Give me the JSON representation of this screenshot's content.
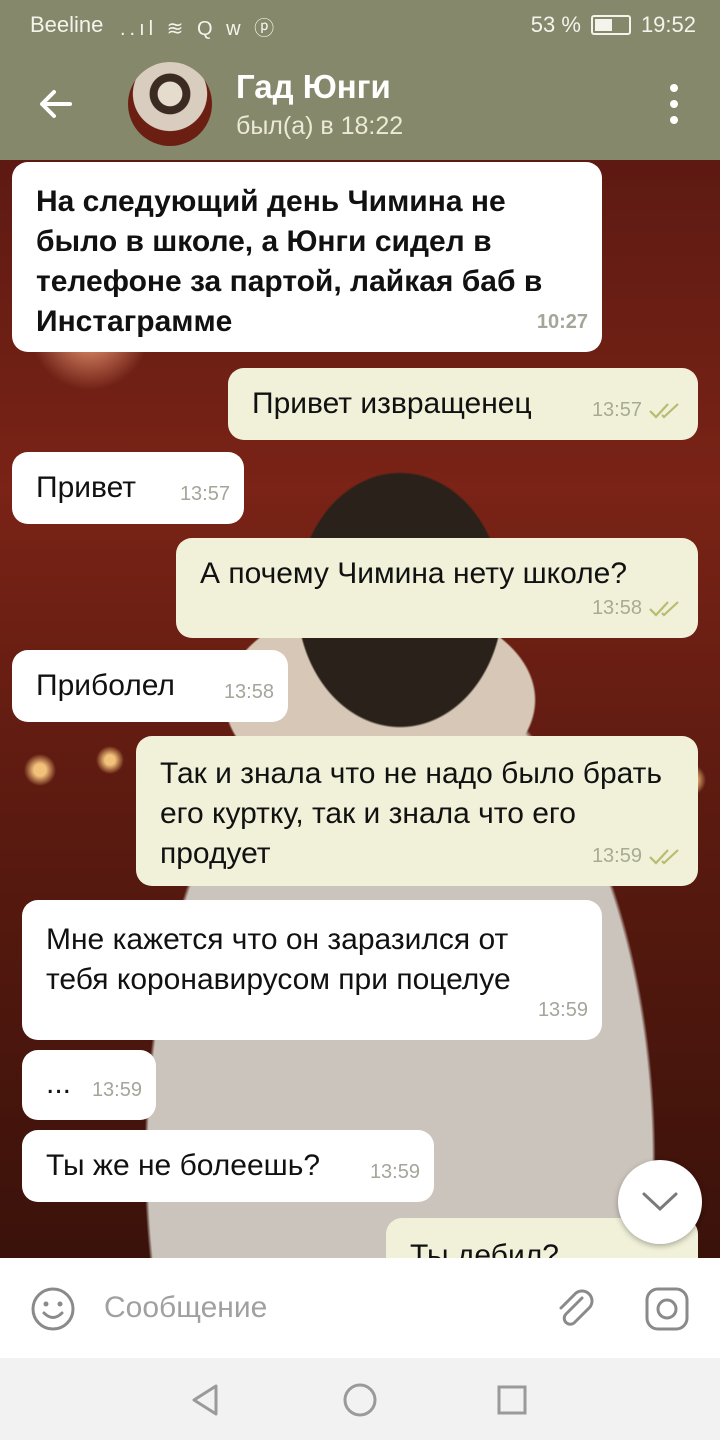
{
  "status_bar": {
    "carrier": "Beeline",
    "signal_icons": "..ıl ≋ Q w ⓟ",
    "battery_percent": "53 %",
    "battery_level": 0.53,
    "time": "19:52"
  },
  "header": {
    "contact_name": "Гад Юнги",
    "last_seen": "был(а) в 18:22"
  },
  "messages": [
    {
      "dir": "in",
      "text": "На следующий день Чимина не было в школе, а Юнги сидел в телефоне за партой, лайкая баб в Инстаграмме",
      "time": "10:27"
    },
    {
      "dir": "out",
      "text": "Привет извращенец",
      "time": "13:57"
    },
    {
      "dir": "in",
      "text": "Привет",
      "time": "13:57"
    },
    {
      "dir": "out",
      "text": "А почему Чимина нету школе?",
      "time": "13:58"
    },
    {
      "dir": "in",
      "text": "Приболел",
      "time": "13:58"
    },
    {
      "dir": "out",
      "text": "Так и знала что не надо было брать его куртку, так и знала что его продует",
      "time": "13:59"
    },
    {
      "dir": "in",
      "text": "Мне кажется что он заразился от тебя коронавирусом при поцелуе",
      "time": "13:59"
    },
    {
      "dir": "in",
      "text": "...",
      "time": "13:59"
    },
    {
      "dir": "in",
      "text": "Ты же не болеешь?",
      "time": "13:59"
    },
    {
      "dir": "out",
      "text": "Ты дебил?",
      "time": ""
    }
  ],
  "input": {
    "placeholder": "Сообщение"
  },
  "icons": {
    "back": "arrow-left-icon",
    "menu": "more-vert-icon",
    "scroll": "chevron-down-icon",
    "emoji": "smile-icon",
    "attach": "paperclip-icon",
    "camera": "instagram-camera-icon",
    "nav_back": "triangle-back-icon",
    "nav_home": "circle-home-icon",
    "nav_recent": "square-recent-icon"
  },
  "colors": {
    "header_bg": "#85886a",
    "bubble_in": "#ffffff",
    "bubble_out": "#f1f0d9",
    "read_check": "#b9bc70"
  }
}
